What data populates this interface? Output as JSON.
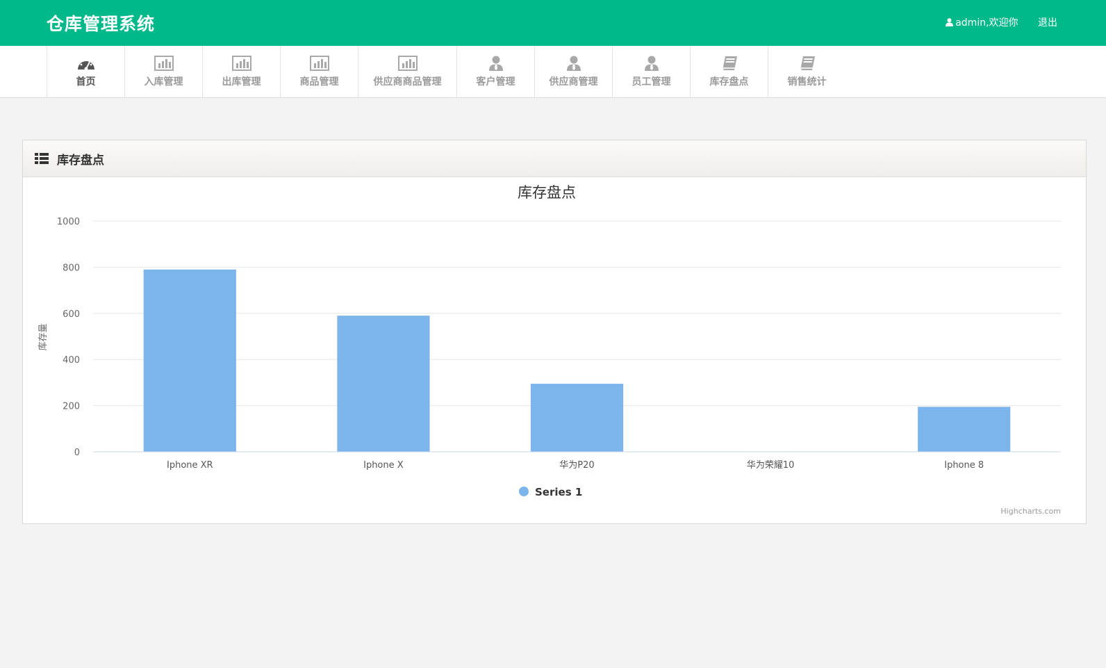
{
  "app": {
    "brand": "仓库管理系统",
    "user_greeting": "admin,欢迎你",
    "logout_label": "退出",
    "accent_color": "#00b98a"
  },
  "nav": {
    "items": [
      {
        "label": "首页",
        "icon": "dashboard-icon",
        "active": true
      },
      {
        "label": "入库管理",
        "icon": "bar-chart-icon"
      },
      {
        "label": "出库管理",
        "icon": "bar-chart-icon"
      },
      {
        "label": "商品管理",
        "icon": "bar-chart-icon"
      },
      {
        "label": "供应商商品管理",
        "icon": "bar-chart-icon"
      },
      {
        "label": "客户管理",
        "icon": "user-tie-icon"
      },
      {
        "label": "供应商管理",
        "icon": "user-tie-icon"
      },
      {
        "label": "员工管理",
        "icon": "user-tie-icon"
      },
      {
        "label": "库存盘点",
        "icon": "book-icon"
      },
      {
        "label": "销售统计",
        "icon": "book-icon"
      }
    ]
  },
  "panel": {
    "title": "库存盘点",
    "icon": "list-icon"
  },
  "chart_data": {
    "type": "bar",
    "title": "库存盘点",
    "ylabel": "库存量",
    "xlabel": "",
    "categories": [
      "Iphone XR",
      "Iphone X",
      "华为P20",
      "华为荣耀10",
      "Iphone 8"
    ],
    "series": [
      {
        "name": "Series 1",
        "values": [
          790,
          590,
          295,
          0,
          195
        ],
        "color": "#7cb5ec"
      }
    ],
    "ylim": [
      0,
      1000
    ],
    "yticks": [
      0,
      200,
      400,
      600,
      800,
      1000
    ],
    "grid": true,
    "legend": "bottom-center",
    "credits": "Highcharts.com"
  }
}
